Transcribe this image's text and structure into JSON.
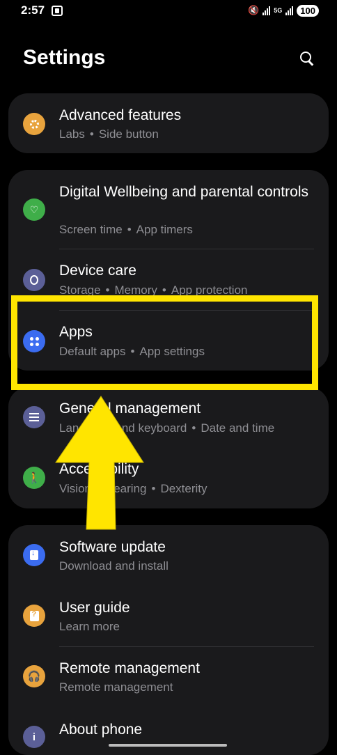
{
  "status_bar": {
    "time": "2:57",
    "network_label": "5G",
    "battery": "100"
  },
  "header": {
    "title": "Settings"
  },
  "groups": [
    {
      "items": [
        {
          "title": "Advanced features",
          "subtitle": [
            "Labs",
            "Side button"
          ],
          "icon": "advanced-features-gear-icon",
          "color": "#e8a33d"
        }
      ]
    },
    {
      "items": [
        {
          "title": "Digital Wellbeing and parental controls",
          "subtitle": [
            "Screen time",
            "App timers"
          ],
          "icon": "digital-wellbeing-heart-icon",
          "color": "#3fae49"
        },
        {
          "title": "Device care",
          "subtitle": [
            "Storage",
            "Memory",
            "App protection"
          ],
          "icon": "device-care-refresh-icon",
          "color": "#5b5f97"
        },
        {
          "title": "Apps",
          "subtitle": [
            "Default apps",
            "App settings"
          ],
          "icon": "apps-grid-icon",
          "color": "#3b6cf0"
        }
      ]
    },
    {
      "items": [
        {
          "title": "General management",
          "subtitle": [
            "Language and keyboard",
            "Date and time"
          ],
          "icon": "general-management-sliders-icon",
          "color": "#5b5f97"
        },
        {
          "title": "Accessibility",
          "subtitle": [
            "Vision",
            "Hearing",
            "Dexterity"
          ],
          "icon": "accessibility-person-icon",
          "color": "#3fae49"
        }
      ]
    },
    {
      "items": [
        {
          "title": "Software update",
          "subtitle": [
            "Download and install"
          ],
          "icon": "software-update-download-icon",
          "color": "#3b6cf0"
        },
        {
          "title": "User guide",
          "subtitle": [
            "Learn more"
          ],
          "icon": "user-guide-book-icon",
          "color": "#e8a33d"
        },
        {
          "title": "Remote management",
          "subtitle": [
            "Remote management"
          ],
          "icon": "remote-management-headset-icon",
          "color": "#e8a33d"
        },
        {
          "title": "About phone",
          "subtitle": [],
          "icon": "about-phone-info-icon",
          "color": "#5b5f97"
        }
      ]
    }
  ],
  "annotation": {
    "highlight_color": "#ffe500",
    "highlighted_item": "Apps"
  }
}
